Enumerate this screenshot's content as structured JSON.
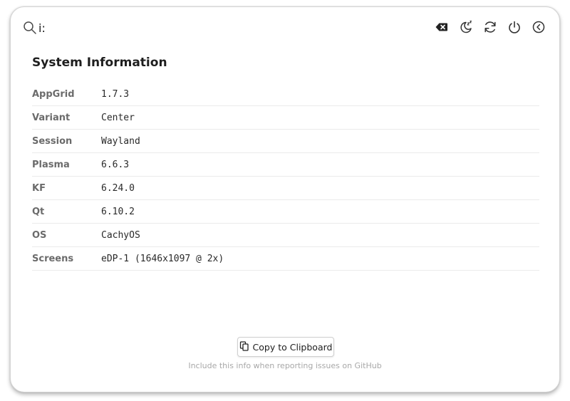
{
  "search": {
    "value": "i:",
    "icon": "search-icon"
  },
  "toolbar": {
    "buttons": [
      {
        "icon": "clear-backspace-icon"
      },
      {
        "icon": "sleep-moon-icon"
      },
      {
        "icon": "refresh-icon"
      },
      {
        "icon": "power-icon"
      },
      {
        "icon": "back-icon"
      }
    ]
  },
  "page": {
    "title": "System Information"
  },
  "info": [
    {
      "key": "AppGrid",
      "value": "1.7.3"
    },
    {
      "key": "Variant",
      "value": "Center"
    },
    {
      "key": "Session",
      "value": "Wayland"
    },
    {
      "key": "Plasma",
      "value": "6.6.3"
    },
    {
      "key": "KF",
      "value": "6.24.0"
    },
    {
      "key": "Qt",
      "value": "6.10.2"
    },
    {
      "key": "OS",
      "value": "CachyOS"
    },
    {
      "key": "Screens",
      "value": "eDP-1 (1646x1097 @ 2x)"
    }
  ],
  "actions": {
    "copy_label": "Copy to Clipboard",
    "copy_icon": "clipboard-icon"
  },
  "hint": "Include this info when reporting issues on GitHub"
}
